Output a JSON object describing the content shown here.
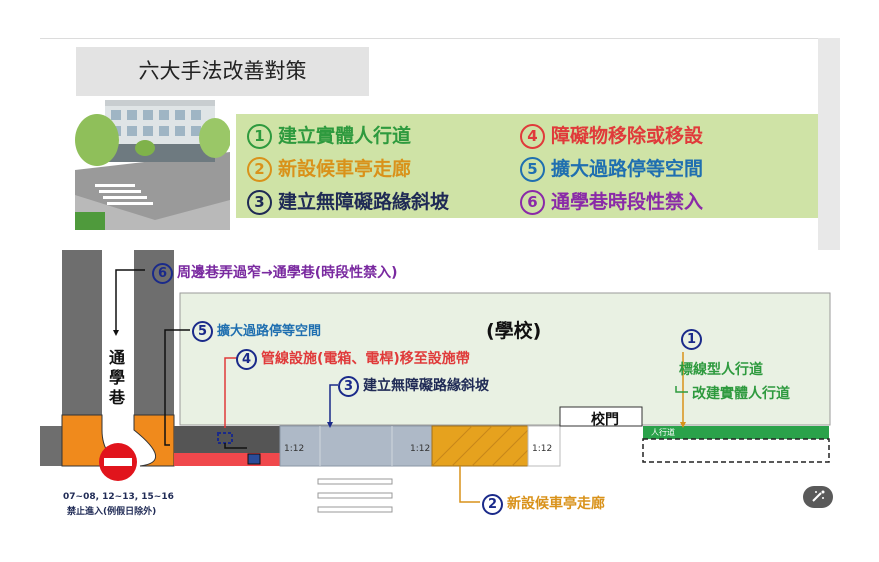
{
  "title": "六大手法改善對策",
  "legend": [
    {
      "num": "1",
      "text": "建立實體人行道",
      "color": "#2e9a3e"
    },
    {
      "num": "2",
      "text": "新設候車亭走廊",
      "color": "#d9921a"
    },
    {
      "num": "3",
      "text": "建立無障礙路緣斜坡",
      "color": "#1f2a55"
    },
    {
      "num": "4",
      "text": "障礙物移除或移設",
      "color": "#e03a3a"
    },
    {
      "num": "5",
      "text": "擴大過路停等空間",
      "color": "#1f6fb0"
    },
    {
      "num": "6",
      "text": "通學巷時段性禁入",
      "color": "#8a2aa8"
    }
  ],
  "diagram": {
    "school_label": "(學校)",
    "alley_label": "通學巷",
    "gate_label": "校門",
    "no_entry_time": "07~08, 12~13, 15~16",
    "no_entry_note": "禁止進入(例假日除外)",
    "ramp_mark": "1:12",
    "sidewalk_mark": "人行道",
    "callouts": {
      "c6": {
        "num": "6",
        "text": "周邊巷弄過窄→通學巷(時段性禁入)"
      },
      "c5": {
        "num": "5",
        "text": "擴大過路停等空間"
      },
      "c4": {
        "num": "4",
        "text": "管線設施(電箱、電桿)移至設施帶"
      },
      "c3": {
        "num": "3",
        "text": "建立無障礙路緣斜坡"
      },
      "c2": {
        "num": "2",
        "text": "新設候車亭走廊"
      },
      "c1": {
        "num": "1",
        "text1": "標線型人行道",
        "text2": "改建實體人行道"
      }
    }
  }
}
